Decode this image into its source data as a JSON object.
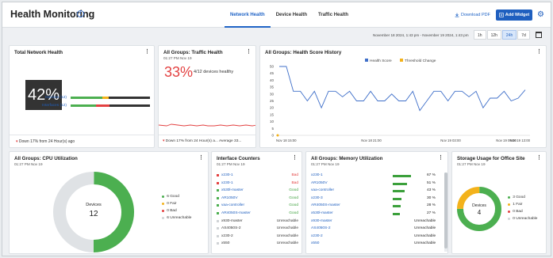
{
  "header": {
    "title": "Health Monitoring",
    "tabs": [
      {
        "label": "Network Health",
        "active": true
      },
      {
        "label": "Device Health",
        "active": false
      },
      {
        "label": "Traffic Health",
        "active": false
      }
    ],
    "download_pdf": "Download PDF",
    "add_widget": "Add Widget"
  },
  "timebar": {
    "range": "November 18 2024, 1:43 pm - November 19 2024, 1:43 pm",
    "buttons": [
      {
        "label": "1h",
        "active": false
      },
      {
        "label": "12h",
        "active": false
      },
      {
        "label": "24h",
        "active": true
      },
      {
        "label": "7d",
        "active": false
      }
    ]
  },
  "total_network": {
    "title": "Total Network Health",
    "pct": "42%",
    "devices_label": "Devices (12)",
    "interfaces_label": "Interfaces (12)",
    "footer": "Down 17% from 24 Hour(s) ago"
  },
  "traffic": {
    "title": "All Groups: Traffic Health",
    "sub": "01:27 PM Nov 19",
    "pct": "33%",
    "text": "4/12 devices healthy",
    "footer": "Down 17% from 24 Hour(s) a... Average 33..."
  },
  "health_history": {
    "title": "All Groups: Health Score History"
  },
  "chart_data": {
    "type": "line",
    "series": [
      {
        "name": "Health Score",
        "color": "#3f6fc9",
        "values": [
          50,
          50,
          32,
          32,
          25,
          32,
          20,
          32,
          32,
          28,
          32,
          25,
          25,
          32,
          25,
          25,
          30,
          25,
          25,
          32,
          18,
          25,
          32,
          32,
          25,
          32,
          32,
          28,
          32,
          20,
          27,
          27,
          32,
          25,
          27,
          33
        ]
      },
      {
        "name": "Threshold Change",
        "color": "#f3b21b",
        "values": []
      }
    ],
    "ylim": [
      0,
      50
    ],
    "yticks": [
      "0",
      "5",
      "10",
      "15",
      "20",
      "25",
      "30",
      "35",
      "40",
      "45",
      "50"
    ],
    "xticks": [
      "Nov 18 15:00",
      "Nov 18 21:00",
      "Nov 19 03:00",
      "Nov 19 09:00",
      "Nov 19 13:00"
    ]
  },
  "cpu": {
    "title": "All Groups: CPU Utilization",
    "sub": "01:27 PM Nov 19",
    "center_label": "Devices",
    "center_value": "12",
    "legend": [
      {
        "label": "6 Good",
        "color": "#4caf50"
      },
      {
        "label": "0 Fair",
        "color": "#f3b21b"
      },
      {
        "label": "0 Bad",
        "color": "#e34141"
      },
      {
        "label": "6 Unreachable",
        "color": "#d0d3d6"
      }
    ]
  },
  "interfaces": {
    "title": "Interface Counters",
    "sub": "01:27 PM Nov 19",
    "rows": [
      {
        "name": "x230-1",
        "status": "Bad",
        "color": "#e34141",
        "link": true
      },
      {
        "name": "x230-1",
        "status": "Bad",
        "color": "#e34141",
        "link": true
      },
      {
        "name": "x530l-master",
        "status": "Good",
        "color": "#4caf50",
        "link": true
      },
      {
        "name": "AR1050V",
        "status": "Good",
        "color": "#4caf50",
        "link": true
      },
      {
        "name": "vaa-controller",
        "status": "Good",
        "color": "#4caf50",
        "link": true
      },
      {
        "name": "AR4050S-master",
        "status": "Good",
        "color": "#4caf50",
        "link": true
      },
      {
        "name": "x930-master",
        "status": "Unreachable",
        "color": "#d0d3d6",
        "link": false
      },
      {
        "name": "AS4050S-2",
        "status": "Unreachable",
        "color": "#d0d3d6",
        "link": false
      },
      {
        "name": "x230-2",
        "status": "Unreachable",
        "color": "#d0d3d6",
        "link": false
      },
      {
        "name": "x550",
        "status": "Unreachable",
        "color": "#d0d3d6",
        "link": false
      }
    ]
  },
  "memory": {
    "title": "All Groups: Memory Utilization",
    "sub": "01:27 PM Nov 19",
    "rows": [
      {
        "name": "x230-1",
        "value": "67 %",
        "pct": 67
      },
      {
        "name": "AR1050V",
        "value": "51 %",
        "pct": 51
      },
      {
        "name": "vaa-controller",
        "value": "43 %",
        "pct": 43
      },
      {
        "name": "x230-3",
        "value": "30 %",
        "pct": 30
      },
      {
        "name": "AR4050S-master",
        "value": "28 %",
        "pct": 28
      },
      {
        "name": "x530l-master",
        "value": "27 %",
        "pct": 27
      },
      {
        "name": "x930-master",
        "value": "Unreachable",
        "pct": 0
      },
      {
        "name": "AS4050S-2",
        "value": "Unreachable",
        "pct": 0
      },
      {
        "name": "x230-2",
        "value": "Unreachable",
        "pct": 0
      },
      {
        "name": "x550",
        "value": "Unreachable",
        "pct": 0
      }
    ]
  },
  "storage": {
    "title": "Storage Usage for Office Site",
    "sub": "01:27 PM Nov 19",
    "center_label": "Devices",
    "center_value": "4",
    "legend": [
      {
        "label": "3 Good",
        "color": "#4caf50"
      },
      {
        "label": "1 Fair",
        "color": "#f3b21b"
      },
      {
        "label": "0 Bad",
        "color": "#e34141"
      },
      {
        "label": "0 Unreachable",
        "color": "#d0d3d6"
      }
    ]
  }
}
